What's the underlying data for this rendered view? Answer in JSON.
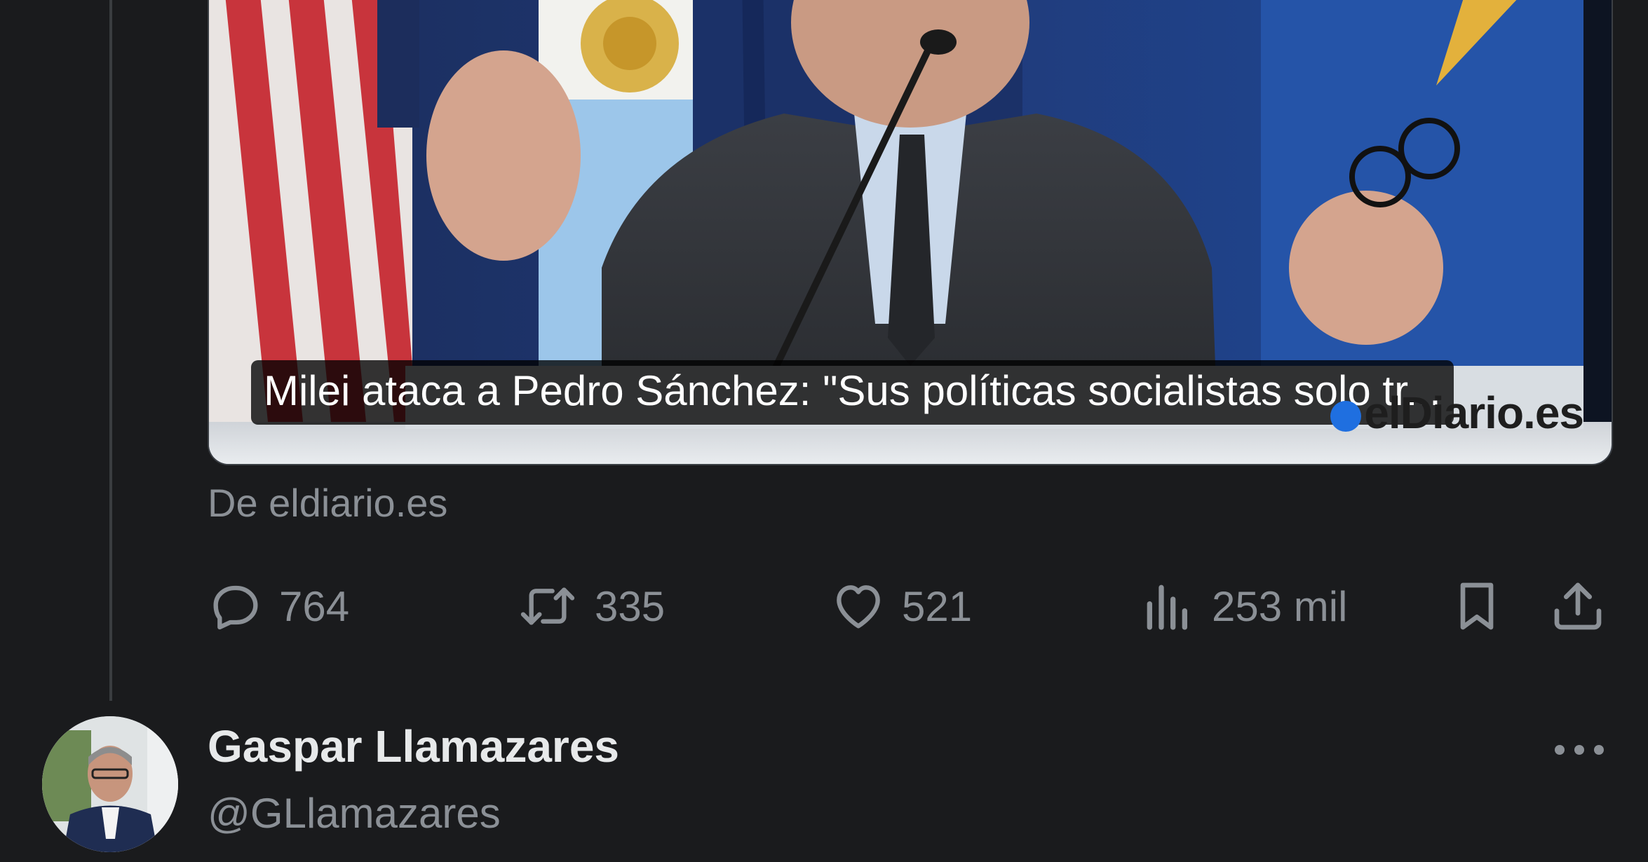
{
  "card": {
    "headline": "Milei ataca a Pedro Sánchez: \"Sus políticas socialistas solo tr...",
    "watermark": "elDiario.es",
    "source": "De eldiario.es"
  },
  "actions": {
    "replies": "764",
    "reposts": "335",
    "likes": "521",
    "views": "253 mil"
  },
  "next_post": {
    "author_name": "Gaspar Llamazares",
    "author_handle": "@GLlamazares"
  },
  "icons": {
    "reply": "reply-bubble-icon",
    "repost": "repost-arrows-icon",
    "like": "heart-icon",
    "views": "bar-chart-icon",
    "bookmark": "bookmark-icon",
    "share": "share-upload-icon",
    "more": "more-dots-icon"
  },
  "colors": {
    "background": "#1a1b1d",
    "muted_text": "#8b9096",
    "primary_text": "#e7e9ea"
  }
}
